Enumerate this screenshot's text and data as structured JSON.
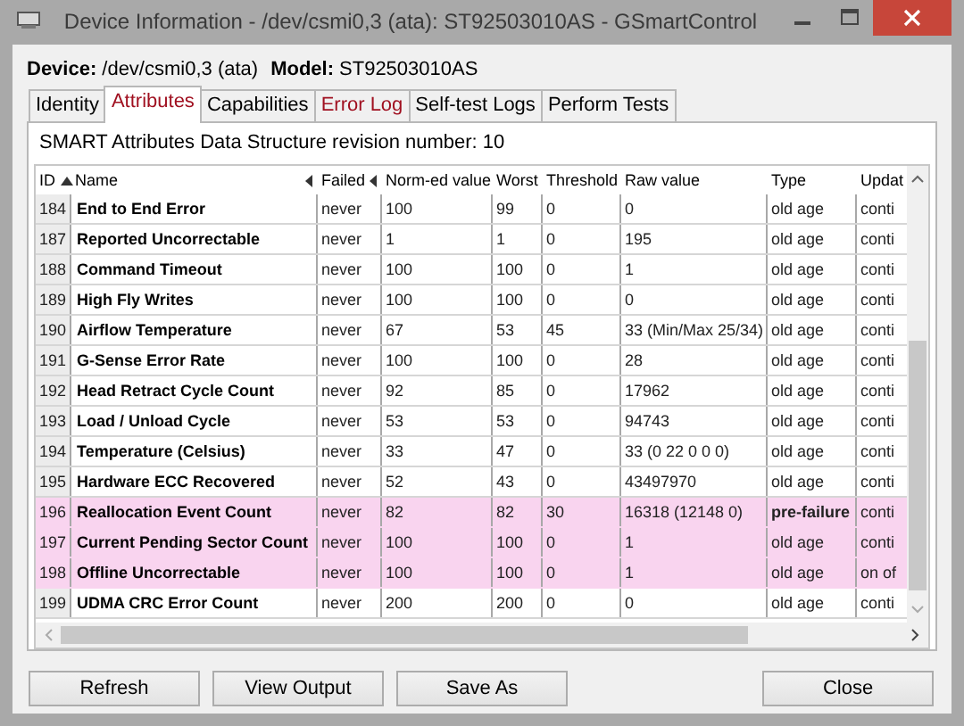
{
  "window": {
    "title": "Device Information - /dev/csmi0,3 (ata): ST92503010AS - GSmartControl"
  },
  "device": {
    "device_label": "Device:",
    "device_value": "/dev/csmi0,3 (ata)",
    "model_label": "Model:",
    "model_value": "ST92503010AS"
  },
  "tabs": [
    {
      "label": "Identity",
      "selected": false,
      "alert": false
    },
    {
      "label": "Attributes",
      "selected": true,
      "alert": true
    },
    {
      "label": "Capabilities",
      "selected": false,
      "alert": false
    },
    {
      "label": "Error Log",
      "selected": false,
      "alert": true
    },
    {
      "label": "Self-test Logs",
      "selected": false,
      "alert": false
    },
    {
      "label": "Perform Tests",
      "selected": false,
      "alert": false
    }
  ],
  "attributes": {
    "revision": "SMART Attributes Data Structure revision number: 10",
    "columns": [
      {
        "label": "ID",
        "kind": "sorted"
      },
      {
        "label": "Name",
        "kind": "marked"
      },
      {
        "label": "Failed",
        "kind": "marked"
      },
      {
        "label": "Norm-ed value",
        "kind": "plain"
      },
      {
        "label": "Worst",
        "kind": "plain"
      },
      {
        "label": "Threshold",
        "kind": "plain"
      },
      {
        "label": "Raw value",
        "kind": "plain"
      },
      {
        "label": "Type",
        "kind": "plain"
      },
      {
        "label": "Updat",
        "kind": "plain"
      }
    ],
    "rows": [
      {
        "id": "184",
        "name": "End to End Error",
        "failed": "never",
        "normed": "100",
        "worst": "99",
        "threshold": "0",
        "raw": "0",
        "type": "old age",
        "updated": "conti",
        "highlighted": false,
        "type_bold": false
      },
      {
        "id": "187",
        "name": "Reported Uncorrectable",
        "failed": "never",
        "normed": "1",
        "worst": "1",
        "threshold": "0",
        "raw": "195",
        "type": "old age",
        "updated": "conti",
        "highlighted": false,
        "type_bold": false
      },
      {
        "id": "188",
        "name": "Command Timeout",
        "failed": "never",
        "normed": "100",
        "worst": "100",
        "threshold": "0",
        "raw": "1",
        "type": "old age",
        "updated": "conti",
        "highlighted": false,
        "type_bold": false
      },
      {
        "id": "189",
        "name": "High Fly Writes",
        "failed": "never",
        "normed": "100",
        "worst": "100",
        "threshold": "0",
        "raw": "0",
        "type": "old age",
        "updated": "conti",
        "highlighted": false,
        "type_bold": false
      },
      {
        "id": "190",
        "name": "Airflow Temperature",
        "failed": "never",
        "normed": "67",
        "worst": "53",
        "threshold": "45",
        "raw": "33 (Min/Max 25/34)",
        "type": "old age",
        "updated": "conti",
        "highlighted": false,
        "type_bold": false
      },
      {
        "id": "191",
        "name": "G-Sense Error Rate",
        "failed": "never",
        "normed": "100",
        "worst": "100",
        "threshold": "0",
        "raw": "28",
        "type": "old age",
        "updated": "conti",
        "highlighted": false,
        "type_bold": false
      },
      {
        "id": "192",
        "name": "Head Retract Cycle Count",
        "failed": "never",
        "normed": "92",
        "worst": "85",
        "threshold": "0",
        "raw": "17962",
        "type": "old age",
        "updated": "conti",
        "highlighted": false,
        "type_bold": false
      },
      {
        "id": "193",
        "name": "Load / Unload Cycle",
        "failed": "never",
        "normed": "53",
        "worst": "53",
        "threshold": "0",
        "raw": "94743",
        "type": "old age",
        "updated": "conti",
        "highlighted": false,
        "type_bold": false
      },
      {
        "id": "194",
        "name": "Temperature (Celsius)",
        "failed": "never",
        "normed": "33",
        "worst": "47",
        "threshold": "0",
        "raw": "33 (0 22 0 0 0)",
        "type": "old age",
        "updated": "conti",
        "highlighted": false,
        "type_bold": false
      },
      {
        "id": "195",
        "name": "Hardware ECC Recovered",
        "failed": "never",
        "normed": "52",
        "worst": "43",
        "threshold": "0",
        "raw": "43497970",
        "type": "old age",
        "updated": "conti",
        "highlighted": false,
        "type_bold": false
      },
      {
        "id": "196",
        "name": "Reallocation Event Count",
        "failed": "never",
        "normed": "82",
        "worst": "82",
        "threshold": "30",
        "raw": "16318 (12148 0)",
        "type": "pre-failure",
        "updated": "conti",
        "highlighted": true,
        "type_bold": true
      },
      {
        "id": "197",
        "name": "Current Pending Sector Count",
        "failed": "never",
        "normed": "100",
        "worst": "100",
        "threshold": "0",
        "raw": "1",
        "type": "old age",
        "updated": "conti",
        "highlighted": true,
        "type_bold": false
      },
      {
        "id": "198",
        "name": "Offline Uncorrectable",
        "failed": "never",
        "normed": "100",
        "worst": "100",
        "threshold": "0",
        "raw": "1",
        "type": "old age",
        "updated": "on of",
        "highlighted": true,
        "type_bold": false
      },
      {
        "id": "199",
        "name": "UDMA CRC Error Count",
        "failed": "never",
        "normed": "200",
        "worst": "200",
        "threshold": "0",
        "raw": "0",
        "type": "old age",
        "updated": "conti",
        "highlighted": false,
        "type_bold": false
      }
    ]
  },
  "buttons": [
    "Refresh",
    "View Output",
    "Save As"
  ],
  "close_button": "Close"
}
